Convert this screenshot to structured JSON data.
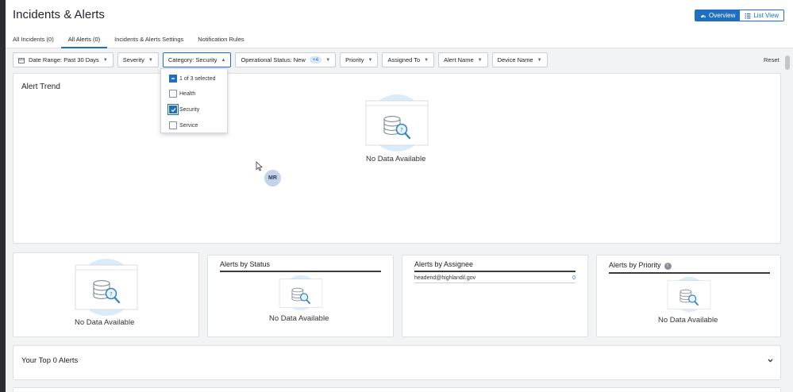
{
  "page": {
    "title": "Incidents & Alerts"
  },
  "view_toggle": {
    "overview_label": "Overview",
    "list_view_label": "List View",
    "active": "Overview"
  },
  "tabs": [
    {
      "label": "All Incidents (0)",
      "active": false
    },
    {
      "label": "All Alerts (0)",
      "active": true
    },
    {
      "label": "Incidents & Alerts Settings",
      "active": false
    },
    {
      "label": "Notification Rules",
      "active": false
    }
  ],
  "filters": {
    "date_range": "Date Range: Past 30 Days",
    "severity": "Severity",
    "category": "Category: Security",
    "operational_status": "Operational Status: New",
    "operational_status_extra": "+4",
    "priority": "Priority",
    "assigned_to": "Assigned To",
    "alert_name": "Alert Name",
    "device_name": "Device Name",
    "reset_label": "Reset"
  },
  "category_dropdown": {
    "summary": "1 of 3 selected",
    "options": [
      {
        "label": "Health",
        "checked": false
      },
      {
        "label": "Security",
        "checked": true
      },
      {
        "label": "Service",
        "checked": false
      }
    ]
  },
  "alert_trend": {
    "title": "Alert Trend",
    "empty_text": "No Data Available"
  },
  "avatar": {
    "initials": "MR"
  },
  "cards": {
    "first": {
      "empty_text": "No Data Available"
    },
    "status": {
      "title": "Alerts by Status",
      "empty_text": "No Data Available"
    },
    "assignee": {
      "title": "Alerts by Assignee",
      "rows": [
        {
          "name": "headend@highlandil.gov",
          "count": "0"
        }
      ]
    },
    "priority": {
      "title": "Alerts by Priority",
      "empty_text": "No Data Available"
    }
  },
  "top_alerts": {
    "title": "Your Top 0 Alerts"
  },
  "colors": {
    "accent": "#1f6fbf",
    "background": "#f2f3f5",
    "illustration": "#dcebf8"
  }
}
